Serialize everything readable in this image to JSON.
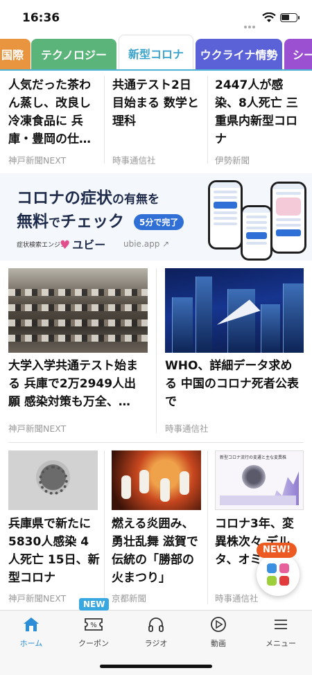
{
  "status_bar": {
    "time": "16:36"
  },
  "tabs": [
    {
      "label": "国際",
      "color": "#e9953f"
    },
    {
      "label": "テクノロジー",
      "color": "#5bb47a"
    },
    {
      "label": "新型コロナ",
      "color": "#ffffff",
      "active": true
    },
    {
      "label": "ウクライナ情勢",
      "color": "#5b61d6"
    },
    {
      "label": "シー",
      "color": "#9b4fd1"
    }
  ],
  "row1": [
    {
      "headline": "人気だった茶わん蒸し、改良し冷凍食品に 兵庫・豊岡の仕…",
      "source": "神戸新聞NEXT"
    },
    {
      "headline": "共通テスト2日目始まる 数学と理科",
      "source": "時事通信社"
    },
    {
      "headline": "2447人が感染、8人死亡 三重県内新型コロナ",
      "source": "伊勢新聞"
    }
  ],
  "ad": {
    "line1_main": "コロナの症状",
    "line1_small": "の有無を",
    "line2_main": "無料",
    "line2_small": "で",
    "line2_main2": "チェック",
    "pill": "5分で完了",
    "engine": "症状検索エンジン",
    "brand": "ユビー",
    "url": "ubie.app"
  },
  "row2": [
    {
      "headline": "大学入学共通テスト始まる 兵庫で2万2949人出願 感染対策も万全、…",
      "source": "神戸新聞NEXT"
    },
    {
      "headline": "WHO、詳細データ求める 中国のコロナ死者公表で",
      "source": "時事通信社"
    }
  ],
  "row3": [
    {
      "headline": "兵庫県で新たに5830人感染 4人死亡 15日、新型コロナ",
      "source": "神戸新聞NEXT"
    },
    {
      "headline": "燃える炎囲み、勇壮乱舞 滋賀で伝統の「勝部の火まつり」",
      "source": "京都新聞"
    },
    {
      "headline": "コロナ3年、変異株次々 デルタ、オミ…続く",
      "source": "時事通信社",
      "image_caption": "新型コロナ流行の変遷と主な変異株"
    }
  ],
  "fab": {
    "badge": "NEW!"
  },
  "bottom_nav": {
    "new_badge": "NEW",
    "items": [
      {
        "label": "ホーム",
        "icon": "home-icon"
      },
      {
        "label": "クーポン",
        "icon": "coupon-icon"
      },
      {
        "label": "ラジオ",
        "icon": "headphones-icon"
      },
      {
        "label": "動画",
        "icon": "play-icon"
      },
      {
        "label": "メニュー",
        "icon": "menu-icon"
      }
    ]
  },
  "colors": {
    "accent": "#2c8ed6",
    "new_orange": "#ec5a21",
    "new_blue": "#3aa8e0"
  }
}
